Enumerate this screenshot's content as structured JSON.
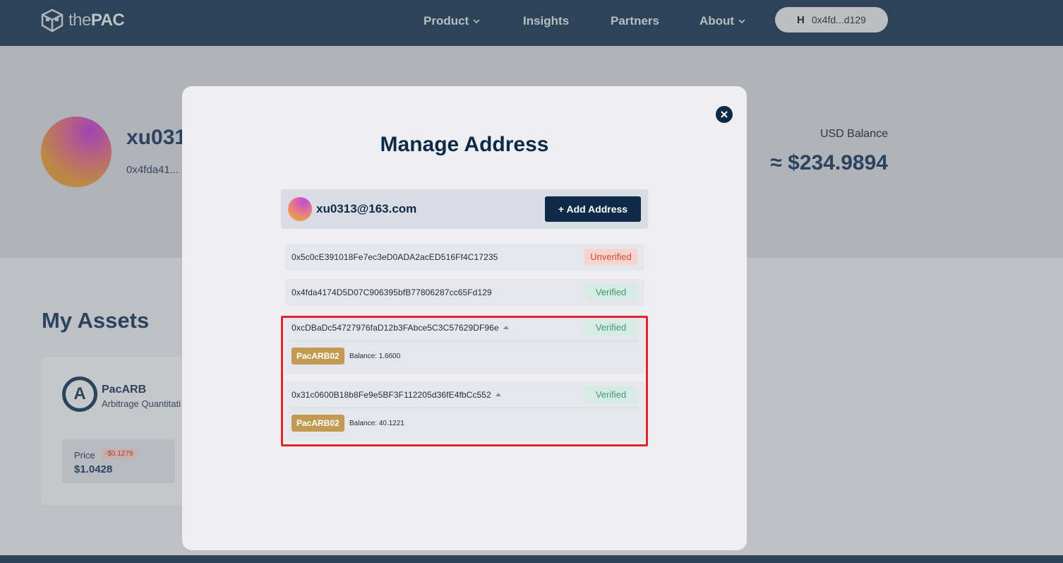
{
  "nav": {
    "logo_prefix": "the",
    "logo_brand": "PAC",
    "items": [
      {
        "label": "Product",
        "has_dropdown": true
      },
      {
        "label": "Insights",
        "has_dropdown": false
      },
      {
        "label": "Partners",
        "has_dropdown": false
      },
      {
        "label": "About",
        "has_dropdown": true
      }
    ],
    "wallet": {
      "icon": "H",
      "label": "0x4fd...d129"
    }
  },
  "profile": {
    "name": "xu031",
    "address": "0x4fda41...",
    "usd_label": "USD Balance",
    "usd_value": "≈ $234.9894"
  },
  "assets": {
    "title": "My Assets",
    "card": {
      "logo_letter": "A",
      "name": "PacARB",
      "subtitle": "Arbitrage Quantitati",
      "price_label": "Price",
      "price_change": "-$0.1279",
      "price_value": "$1.0428"
    }
  },
  "modal": {
    "title": "Manage Address",
    "account_email": "xu0313@163.com",
    "add_button": "+ Add Address",
    "addresses": [
      {
        "address": "0x5c0cE391018Fe7ec3eD0ADA2acED516Ff4C17235",
        "status": "Unverified",
        "expanded": false
      },
      {
        "address": "0x4fda4174D5D07C906395bfB77806287cc65Fd129",
        "status": "Verified",
        "expanded": false
      },
      {
        "address": "0xcDBaDc54727976faD12b3FAbce5C3C57629DF96e",
        "status": "Verified",
        "expanded": true,
        "token": "PacARB02",
        "balance": "Balance: 1.6600"
      },
      {
        "address": "0x31c0600B18b8Fe9e5BF3F112205d36fE4fbCc552",
        "status": "Verified",
        "expanded": true,
        "token": "PacARB02",
        "balance": "Balance: 40.1221"
      }
    ]
  },
  "colors": {
    "nav_bg": "#2e4a62",
    "primary": "#0d2a47",
    "verified": "#3f9a79",
    "unverified": "#c64a38",
    "token_tag": "#c39a52",
    "highlight": "#e3242b"
  },
  "icons": {
    "close": "close-icon",
    "chevron": "chevron-down-icon",
    "caret": "caret-up-icon",
    "wallet": "wallet-icon"
  }
}
